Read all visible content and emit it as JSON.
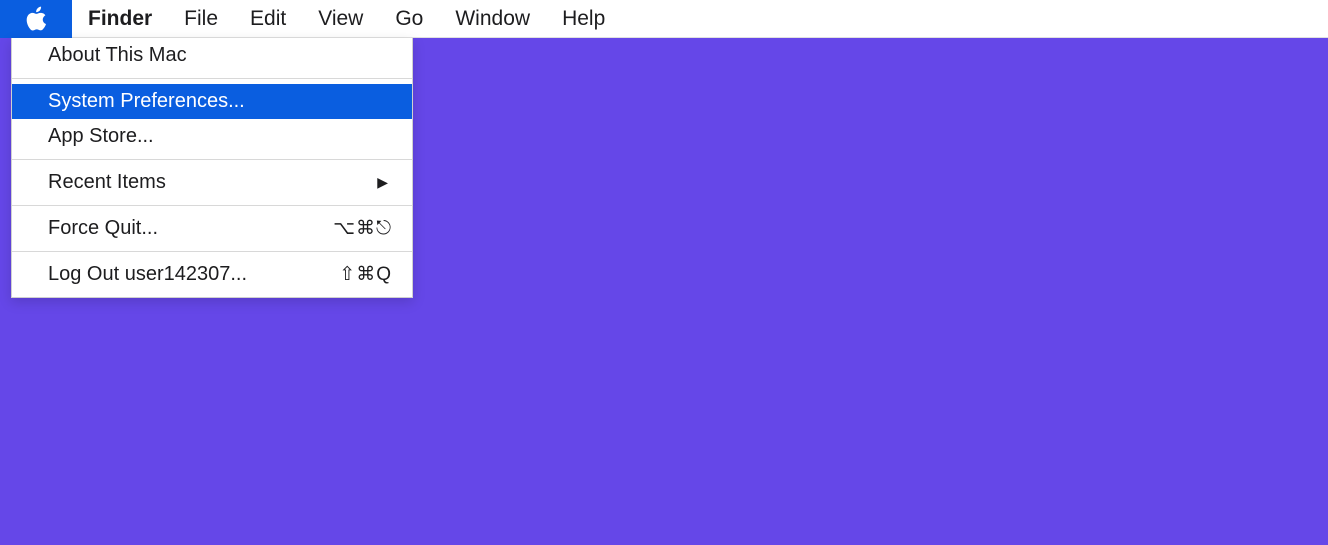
{
  "menubar": {
    "appName": "Finder",
    "items": [
      "File",
      "Edit",
      "View",
      "Go",
      "Window",
      "Help"
    ]
  },
  "appleMenu": {
    "about": "About This Mac",
    "systemPreferences": "System Preferences...",
    "appStore": "App Store...",
    "recentItems": "Recent Items",
    "forceQuit": "Force Quit...",
    "forceQuitShortcut": "⌥⌘⎋",
    "logOut": "Log Out user142307...",
    "logOutShortcut": "⇧⌘Q"
  }
}
